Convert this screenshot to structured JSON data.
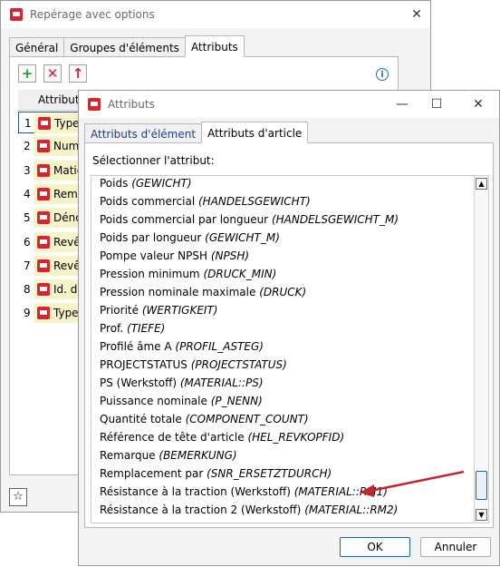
{
  "back_window": {
    "title": "Repérage avec options",
    "tabs": [
      "Général",
      "Groupes d'éléments",
      "Attributs"
    ],
    "toolbar": {
      "add": "+",
      "delete": "✕",
      "info": "i"
    },
    "table_header": "Attribut",
    "rows": [
      {
        "num": "1",
        "label": "Type"
      },
      {
        "num": "2",
        "label": "Num"
      },
      {
        "num": "3",
        "label": "Matié"
      },
      {
        "num": "4",
        "label": "Rema"
      },
      {
        "num": "5",
        "label": "Déno"
      },
      {
        "num": "6",
        "label": "Revêt"
      },
      {
        "num": "7",
        "label": "Revêt"
      },
      {
        "num": "8",
        "label": "Id. de"
      },
      {
        "num": "9",
        "label": "Type"
      }
    ],
    "star_icon": "☆"
  },
  "dialog": {
    "title": "Attributs",
    "tabs": [
      "Attributs d'élément",
      "Attributs d'article"
    ],
    "prompt": "Sélectionner l'attribut:",
    "items": [
      {
        "name": "Poids",
        "key": "(GEWICHT)"
      },
      {
        "name": "Poids commercial",
        "key": "(HANDELSGEWICHT)"
      },
      {
        "name": "Poids commercial par longueur",
        "key": "(HANDELSGEWICHT_M)"
      },
      {
        "name": "Poids par longueur",
        "key": "(GEWICHT_M)"
      },
      {
        "name": "Pompe valeur NPSH",
        "key": "(NPSH)"
      },
      {
        "name": "Pression minimum",
        "key": "(DRUCK_MIN)"
      },
      {
        "name": "Pression nominale maximale",
        "key": "(DRUCK)"
      },
      {
        "name": "Priorité",
        "key": "(WERTIGKEIT)"
      },
      {
        "name": "Prof.",
        "key": "(TIEFE)"
      },
      {
        "name": "Profilé âme A",
        "key": "(PROFIL_ASTEG)"
      },
      {
        "name": "PROJECTSTATUS",
        "key": "(PROJECTSTATUS)"
      },
      {
        "name": "PS (Werkstoff)",
        "key": "(MATERIAL::PS)"
      },
      {
        "name": "Puissance nominale",
        "key": "(P_NENN)"
      },
      {
        "name": "Quantité totale",
        "key": "(COMPONENT_COUNT)"
      },
      {
        "name": "Référence de tête d'article",
        "key": "(HEL_REVKOPFID)"
      },
      {
        "name": "Remarque",
        "key": "(BEMERKUNG)"
      },
      {
        "name": "Remplacement par",
        "key": "(SNR_ERSETZTDURCH)"
      },
      {
        "name": "Résistance à la traction (Werkstoff)",
        "key": "(MATERIAL::RM1)"
      },
      {
        "name": "Résistance à la traction 2 (Werkstoff)",
        "key": "(MATERIAL::RM2)"
      }
    ],
    "ok_label": "OK",
    "cancel_label": "Annuler"
  },
  "colors": {
    "accent_red": "#d9232e",
    "arrow_red": "#c0262d",
    "scroll_thumb_border": "#0a64c8"
  }
}
